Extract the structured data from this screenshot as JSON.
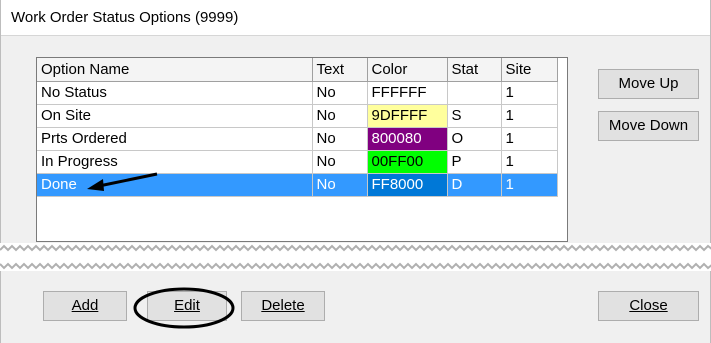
{
  "window": {
    "title": "Work Order Status Options (9999)"
  },
  "grid": {
    "columns": [
      "Option Name",
      "Text",
      "Color",
      "Stat",
      "Site"
    ],
    "rows": [
      {
        "name": "No Status",
        "text": "No",
        "color": "FFFFFF",
        "color_hex": "#FFFFFF",
        "stat": "",
        "site": "1"
      },
      {
        "name": "On Site",
        "text": "No",
        "color": "9DFFFF",
        "color_hex": "#FFFF9D",
        "stat": "S",
        "site": "1"
      },
      {
        "name": "Prts Ordered",
        "text": "No",
        "color": "800080",
        "color_hex": "#800080",
        "stat": "O",
        "site": "1"
      },
      {
        "name": "In Progress",
        "text": "No",
        "color": "00FF00",
        "color_hex": "#00FF00",
        "stat": "P",
        "site": "1"
      },
      {
        "name": "Done",
        "text": "No",
        "color": "FF8000",
        "color_hex": "#0078D7",
        "stat": "D",
        "site": "1"
      }
    ],
    "selected_row": "Done"
  },
  "buttons": {
    "move_up": "Move Up",
    "move_down": "Move Down",
    "add": "Add",
    "edit": "Edit",
    "delete": "Delete",
    "close": "Close"
  }
}
